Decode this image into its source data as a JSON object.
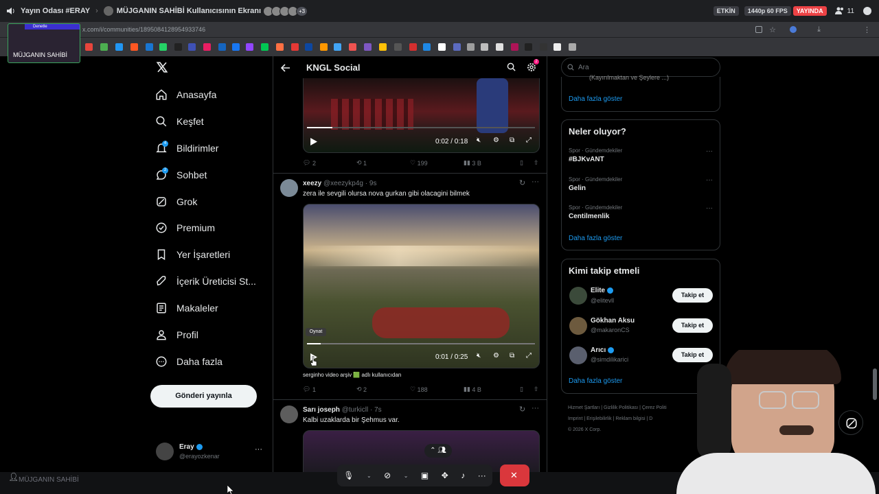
{
  "discord": {
    "room": "Yayın Odası #ERAY",
    "title": "MÜJGANIN SAHİBİ Kullanıcısının Ekranı",
    "extra_count": "+3",
    "status_label": "ETKİN",
    "quality": "1440p 60 FPS",
    "live_label": "YAYINDA",
    "viewer_count": "11",
    "stream_label": "MÜJGANIN SAHİBİ",
    "stream_badge": "Denetle",
    "bottom_user": "MÜJGANIN SAHİBİ"
  },
  "browser": {
    "url": "x.com/i/communities/1895084128954933746"
  },
  "sidebar": {
    "items": [
      {
        "label": "Anasayfa",
        "icon": "home-icon"
      },
      {
        "label": "Keşfet",
        "icon": "search-icon"
      },
      {
        "label": "Bildirimler",
        "icon": "bell-icon",
        "badge": "4"
      },
      {
        "label": "Sohbet",
        "icon": "chat-icon",
        "badge": "2"
      },
      {
        "label": "Grok",
        "icon": "grok-icon"
      },
      {
        "label": "Premium",
        "icon": "premium-icon"
      },
      {
        "label": "Yer İşaretleri",
        "icon": "bookmark-icon"
      },
      {
        "label": "İçerik Üreticisi St...",
        "icon": "rocket-icon"
      },
      {
        "label": "Makaleler",
        "icon": "article-icon"
      },
      {
        "label": "Profil",
        "icon": "person-icon"
      },
      {
        "label": "Daha fazla",
        "icon": "more-circle-icon"
      }
    ],
    "post_button": "Gönderi yayınla",
    "user_name": "Eray",
    "user_handle": "@erayozkenar"
  },
  "timeline": {
    "title": "KNGL Social",
    "settings_badge": "2",
    "tweet1": {
      "video_time": "0:02 / 0:18",
      "replies": "2",
      "retweets": "1",
      "likes": "199",
      "views": "3 B"
    },
    "tweet2": {
      "name": "xeezy",
      "handle": "@xeezykp4g",
      "time": "· 9s",
      "text": "zera ile sevgili olursa nova gurkan gibi olacagini bilmek",
      "tooltip": "Oynat",
      "video_time": "0:01 / 0:25",
      "caption": "serginho video arşiv 🟩 adlı kullanıcıdan",
      "replies": "1",
      "retweets": "2",
      "likes": "188",
      "views": "4 B"
    },
    "tweet3": {
      "name": "Sarı joseph",
      "handle": "@turkicll",
      "time": "· 7s",
      "text": "Kalbi uzaklarda bir Şehmus var."
    }
  },
  "right": {
    "search_placeholder": "Ara",
    "top_more": "Daha fazla göster",
    "top_partial": "(Kayırılmaktan ve Şeylere ...)",
    "trends_title": "Neler oluyor?",
    "trends": [
      {
        "meta": "Spor · Gündemdekiler",
        "name": "#BJKvANT"
      },
      {
        "meta": "Spor · Gündemdekiler",
        "name": "Gelin"
      },
      {
        "meta": "Spor · Gündemdekiler",
        "name": "Centilmenlik"
      }
    ],
    "trends_more": "Daha fazla göster",
    "follow_title": "Kimi takip etmeli",
    "follow": [
      {
        "name": "Elite",
        "handle": "@elitevll",
        "btn": "Takip et"
      },
      {
        "name": "Gökhan Aksu",
        "handle": "@makaronCS",
        "btn": "Takip et"
      },
      {
        "name": "Arıcı",
        "handle": "@simdilikarici",
        "btn": "Takip et"
      }
    ],
    "follow_more": "Daha fazla göster",
    "footer": {
      "l1": "Hizmet Şartları | Gizlilik Politikası | Çerez Politi",
      "l2": "Imprint | Erişilebilirlik | Reklam bilgisi | D",
      "l3": "© 2026 X Corp."
    }
  },
  "colors": {
    "accent": "#1d9bf0",
    "live": "#ed4245",
    "endcall": "#da373c"
  }
}
